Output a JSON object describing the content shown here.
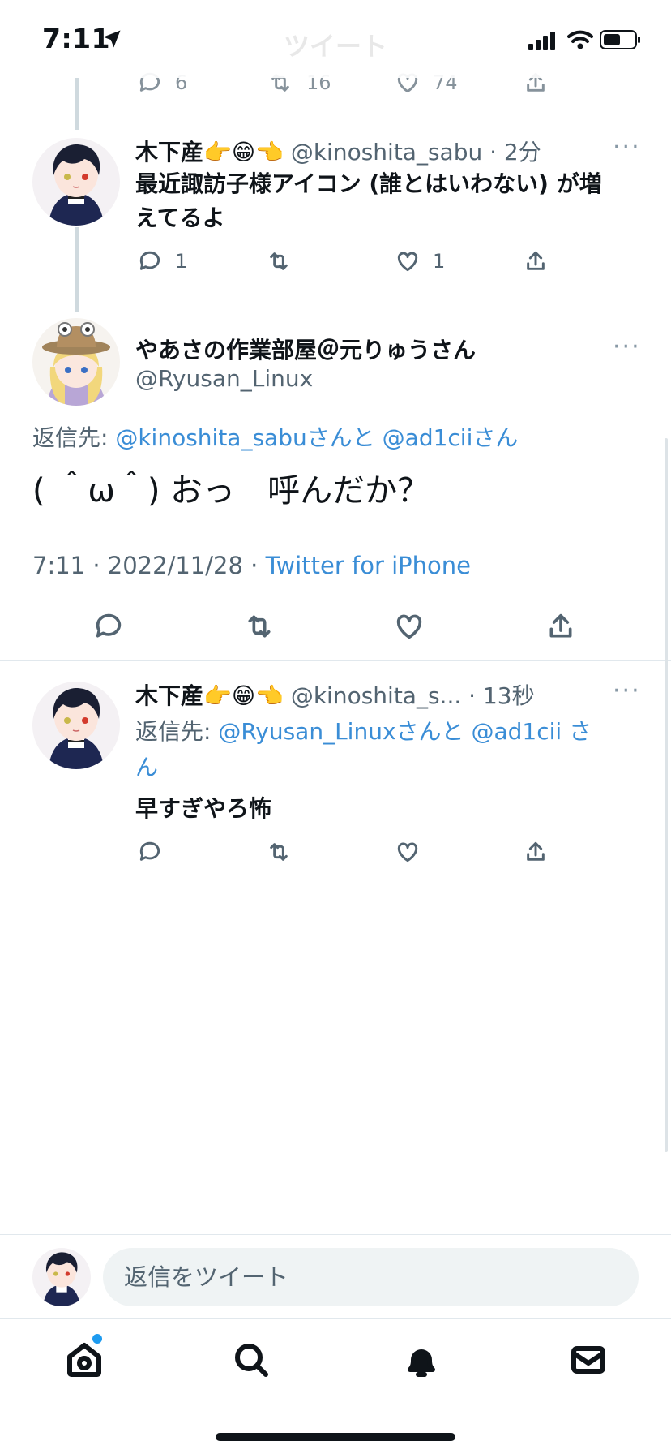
{
  "status": {
    "time": "7:11"
  },
  "header": {
    "title": "ツイート"
  },
  "prev_tweet": {
    "reply_count": "6",
    "retweet_count": "16",
    "like_count": "74"
  },
  "tweet1": {
    "name": "木下産👉😁👈",
    "handle": "@kinoshita_sabu",
    "time": "· 2分",
    "text_line1": "最近諏訪子様アイコン (誰とはいわない) が増",
    "text_line2": "えてるよ",
    "reply_count": "1",
    "like_count": "1"
  },
  "main_tweet": {
    "name": "やあさの作業部屋＠元りゅうさん",
    "handle": "@Ryusan_Linux",
    "reply_to_label": "返信先:",
    "reply_to_user1": "@kinoshita_sabu",
    "reply_to_san1": "さんと",
    "reply_to_user2": "@ad1cii",
    "reply_to_san2": "さん",
    "text": "( ＾ω＾) おっ　呼んだか？",
    "timestamp": "7:11 · 2022/11/28 ·",
    "source": "Twitter for iPhone"
  },
  "reply_tweet": {
    "name": "木下産👉😁👈",
    "handle": "@kinoshita_s...",
    "time": "· 13秒",
    "reply_to_label": "返信先:",
    "reply_to_user1": "@Ryusan_Linux",
    "reply_to_san1": "さんと",
    "reply_to_user2": "@ad1cii",
    "reply_to_san2a": "さ",
    "reply_to_san2b": "ん",
    "text": "早すぎやろ怖"
  },
  "composer": {
    "placeholder": "返信をツイート"
  },
  "colors": {
    "link": "#3a8dd6",
    "notification_dot": "#1d9bf0"
  },
  "tabs": [
    "home-icon",
    "search-icon",
    "bell-icon",
    "mail-icon"
  ]
}
